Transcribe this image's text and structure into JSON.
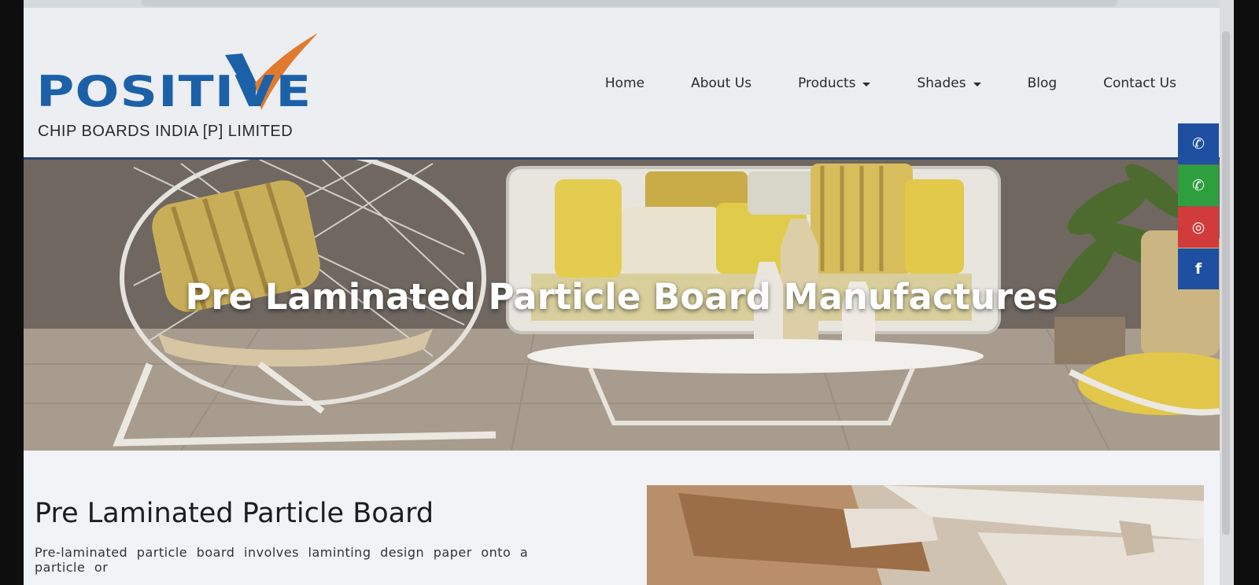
{
  "brand": {
    "name": "POSITIVE",
    "tagline": "CHIP BOARDS INDIA [P] LIMITED",
    "primary_color": "#1c61a8",
    "accent_color": "#e07a2e"
  },
  "nav": {
    "items": [
      {
        "label": "Home",
        "dropdown": false
      },
      {
        "label": "About Us",
        "dropdown": false
      },
      {
        "label": "Products",
        "dropdown": true
      },
      {
        "label": "Shades",
        "dropdown": true
      },
      {
        "label": "Blog",
        "dropdown": false
      },
      {
        "label": "Contact Us",
        "dropdown": false
      }
    ]
  },
  "hero": {
    "caption": "Pre Laminated Particle Board Manufactures"
  },
  "social": [
    {
      "name": "phone-icon",
      "glyph": "✆",
      "color": "#1f4fa0"
    },
    {
      "name": "whatsapp-icon",
      "glyph": "✆",
      "color": "#2e9e3f"
    },
    {
      "name": "instagram-icon",
      "glyph": "◎",
      "color": "#d23b3b"
    },
    {
      "name": "facebook-icon",
      "glyph": "f",
      "color": "#1f4fa0"
    }
  ],
  "section": {
    "title": "Pre Laminated Particle Board",
    "text": "Pre-laminated particle board involves laminting design paper onto a particle or"
  }
}
